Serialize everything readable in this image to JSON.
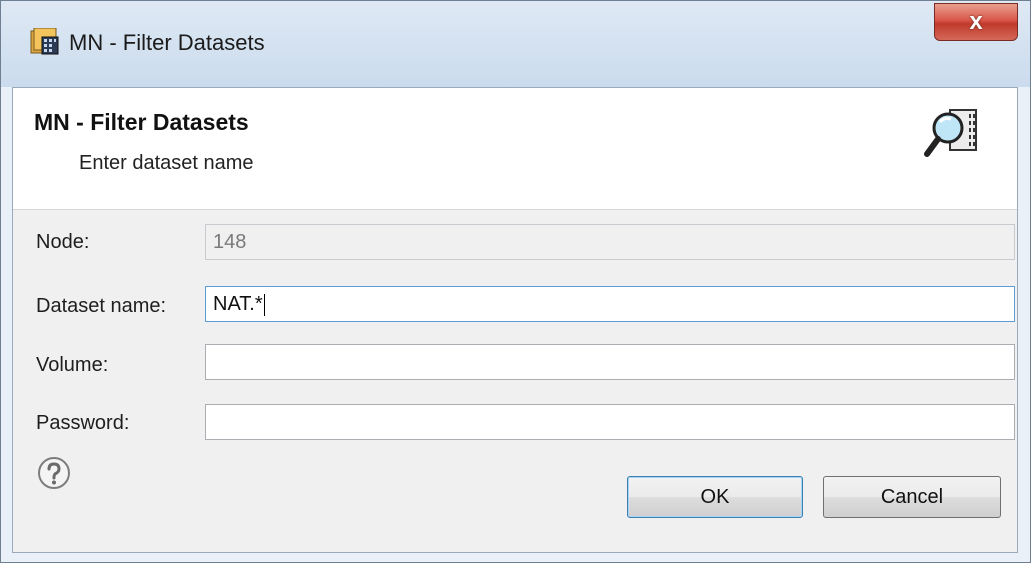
{
  "window": {
    "title": "MN - Filter Datasets",
    "close_label": "x"
  },
  "header": {
    "title": "MN - Filter Datasets",
    "subtitle": "Enter dataset name",
    "icon": "dataset-search-icon"
  },
  "form": {
    "node": {
      "label": "Node:",
      "value": "148",
      "enabled": false
    },
    "dataset_name": {
      "label": "Dataset name:",
      "value": "NAT.*",
      "focused": true
    },
    "volume": {
      "label": "Volume:",
      "value": ""
    },
    "password": {
      "label": "Password:",
      "value": ""
    }
  },
  "footer": {
    "help_icon": "help-icon",
    "ok_label": "OK",
    "cancel_label": "Cancel"
  },
  "colors": {
    "title_bar": "#d3e1f0",
    "close_button": "#c9473a",
    "focus_border": "#5c9cd9",
    "default_button_border": "#3c7fb1"
  }
}
